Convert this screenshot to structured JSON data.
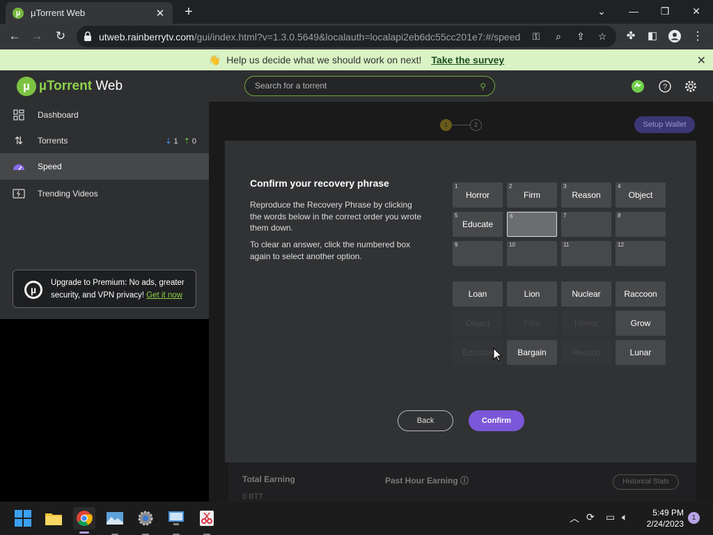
{
  "browser": {
    "tab_title": "µTorrent Web",
    "url_host": "utweb.rainberrytv.com",
    "url_rest": "/gui/index.html?v=1.3.0.5649&localauth=localapi2eb6dc55cc201e7:#/speed"
  },
  "banner": {
    "emoji": "👋",
    "text": "Help us decide what we should work on next!",
    "link": "Take the survey"
  },
  "app": {
    "logo_brand": "µTorrent",
    "logo_suffix": " Web",
    "search_placeholder": "Search for a torrent"
  },
  "sidebar": {
    "items": [
      {
        "label": "Dashboard"
      },
      {
        "label": "Torrents",
        "down": "1",
        "up": "0"
      },
      {
        "label": "Speed"
      },
      {
        "label": "Trending Videos"
      }
    ],
    "upgrade_text": "Upgrade to Premium: No ads, greater security, and VPN privacy!",
    "upgrade_link": "Get it now"
  },
  "background": {
    "step1": "1",
    "step2": "2",
    "setup_wallet": "Setup Wallet",
    "total_earning": "Total Earning",
    "past_hour": "Past Hour Earning",
    "btt_value": "0  BTT",
    "historical": "Historical Stats"
  },
  "modal": {
    "title": "Confirm your recovery phrase",
    "desc1": "Reproduce the Recovery Phrase by clicking the words below in the correct order you wrote them down.",
    "desc2": "To clear an answer, click the numbered box again to select another option.",
    "slots": [
      {
        "n": "1",
        "w": "Horror"
      },
      {
        "n": "2",
        "w": "Firm"
      },
      {
        "n": "3",
        "w": "Reason"
      },
      {
        "n": "4",
        "w": "Object"
      },
      {
        "n": "5",
        "w": "Educate"
      },
      {
        "n": "6",
        "w": ""
      },
      {
        "n": "7",
        "w": ""
      },
      {
        "n": "8",
        "w": ""
      },
      {
        "n": "9",
        "w": ""
      },
      {
        "n": "10",
        "w": ""
      },
      {
        "n": "11",
        "w": ""
      },
      {
        "n": "12",
        "w": ""
      }
    ],
    "options": [
      {
        "w": "Loan",
        "used": false
      },
      {
        "w": "Lion",
        "used": false
      },
      {
        "w": "Nuclear",
        "used": false
      },
      {
        "w": "Raccoon",
        "used": false
      },
      {
        "w": "Object",
        "used": true
      },
      {
        "w": "Firm",
        "used": true
      },
      {
        "w": "Horror",
        "used": true
      },
      {
        "w": "Grow",
        "used": false
      },
      {
        "w": "Educate",
        "used": true
      },
      {
        "w": "Bargain",
        "used": false
      },
      {
        "w": "Reason",
        "used": true
      },
      {
        "w": "Lunar",
        "used": false
      }
    ],
    "back": "Back",
    "confirm": "Confirm"
  },
  "taskbar": {
    "time": "5:49 PM",
    "date": "2/24/2023",
    "notifications": "1"
  }
}
